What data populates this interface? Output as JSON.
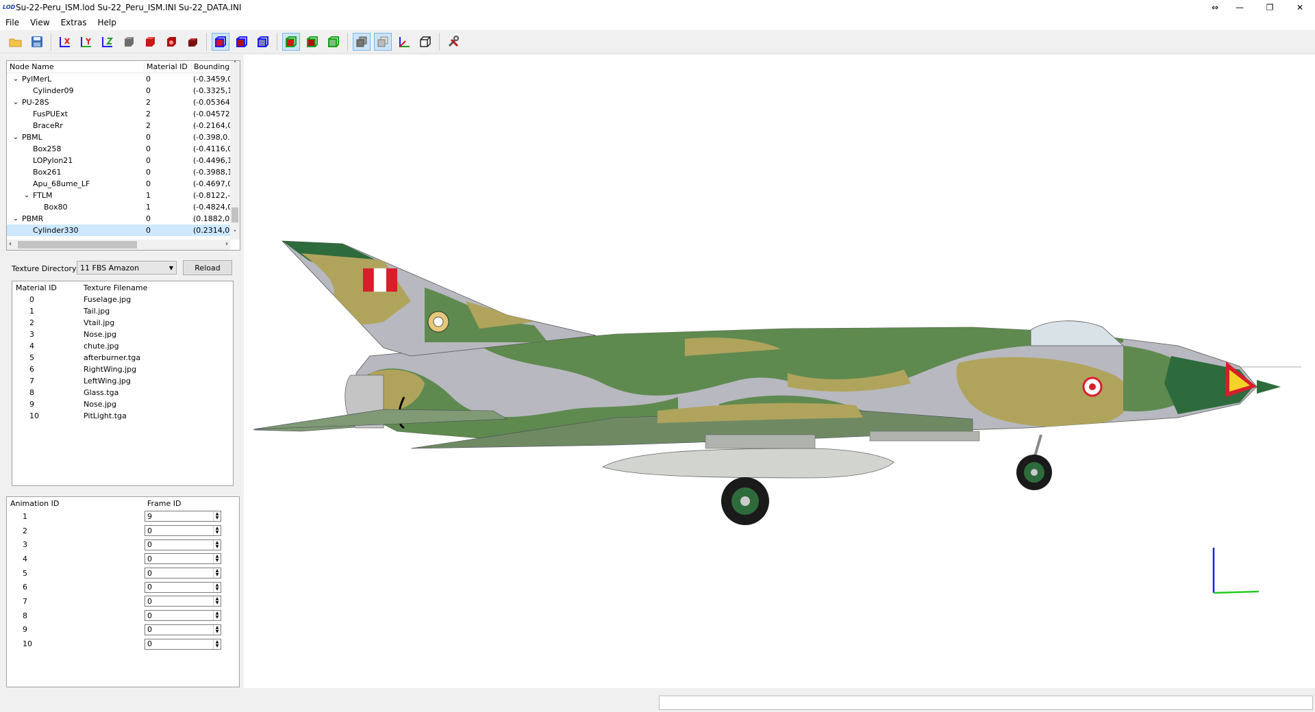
{
  "window": {
    "title": "Su-22-Peru_ISM.lod  Su-22_Peru_ISM.INI  Su-22_DATA.INI",
    "app_icon": "LOD",
    "controls": [
      "resize-icon",
      "minimize-icon",
      "restore-icon",
      "close-icon"
    ]
  },
  "menu": {
    "items": [
      "File",
      "View",
      "Extras",
      "Help"
    ]
  },
  "toolbar": {
    "icons": [
      "open-folder-icon",
      "save-icon",
      "rotate-x-icon",
      "rotate-y-icon",
      "rotate-z-icon",
      "shade-gray-icon",
      "shade-red-icon",
      "shade-red-sphere-icon",
      "shade-red-box-icon",
      "cube-blue-icon",
      "cube-blue-solid-icon",
      "cube-blue-outline-icon",
      "cube-green-icon",
      "cube-green-solid-icon",
      "cube-green-outline-icon",
      "layers-icon",
      "layers-alt-icon",
      "axes-icon",
      "box-outline-icon",
      "tools-icon"
    ]
  },
  "node_tree": {
    "headers": [
      "Node Name",
      "Material ID",
      "Bounding"
    ],
    "rows": [
      {
        "indent": 1,
        "expander": "v",
        "name": "PylMerL",
        "material": "0",
        "bounding": "(-0.3459,0"
      },
      {
        "indent": 2,
        "expander": "",
        "name": "Cylinder09",
        "material": "0",
        "bounding": "(-0.3325,1"
      },
      {
        "indent": 1,
        "expander": "v",
        "name": "PU-28S",
        "material": "2",
        "bounding": "(-0.05364,"
      },
      {
        "indent": 2,
        "expander": "",
        "name": "FusPUExt",
        "material": "2",
        "bounding": "(-0.04572,"
      },
      {
        "indent": 2,
        "expander": "",
        "name": "BraceRr",
        "material": "2",
        "bounding": "(-0.2164,0"
      },
      {
        "indent": 1,
        "expander": "v",
        "name": "PBML",
        "material": "0",
        "bounding": "(-0.398,0."
      },
      {
        "indent": 2,
        "expander": "",
        "name": "Box258",
        "material": "0",
        "bounding": "(-0.4116,0"
      },
      {
        "indent": 2,
        "expander": "",
        "name": "LOPylon21",
        "material": "0",
        "bounding": "(-0.4496,1"
      },
      {
        "indent": 2,
        "expander": "",
        "name": "Box261",
        "material": "0",
        "bounding": "(-0.3988,1"
      },
      {
        "indent": 2,
        "expander": "",
        "name": "Apu_68ume_LF",
        "material": "0",
        "bounding": "(-0.4697,0"
      },
      {
        "indent": 2,
        "expander": "v",
        "name": "FTLM",
        "material": "1",
        "bounding": "(-0.8122,-"
      },
      {
        "indent": 3,
        "expander": "",
        "name": "Box80",
        "material": "1",
        "bounding": "(-0.4824,0"
      },
      {
        "indent": 1,
        "expander": "v",
        "name": "PBMR",
        "material": "0",
        "bounding": "(0.1882,0."
      },
      {
        "indent": 2,
        "expander": "",
        "name": "Cylinder330",
        "material": "0",
        "bounding": "(0.2314,0."
      }
    ]
  },
  "texture": {
    "dir_label": "Texture Directory:",
    "dir_value": "11 FBS Amazon",
    "reload_label": "Reload",
    "headers": [
      "Material ID",
      "Texture Filename"
    ],
    "rows": [
      {
        "id": "0",
        "file": "Fuselage.jpg"
      },
      {
        "id": "1",
        "file": "Tail.jpg"
      },
      {
        "id": "2",
        "file": "Vtail.jpg"
      },
      {
        "id": "3",
        "file": "Nose.jpg"
      },
      {
        "id": "4",
        "file": "chute.jpg"
      },
      {
        "id": "5",
        "file": "afterburner.tga"
      },
      {
        "id": "6",
        "file": "RightWing.jpg"
      },
      {
        "id": "7",
        "file": "LeftWing.jpg"
      },
      {
        "id": "8",
        "file": "Glass.tga"
      },
      {
        "id": "9",
        "file": "Nose.jpg"
      },
      {
        "id": "10",
        "file": "PitLight.tga"
      }
    ]
  },
  "animation": {
    "headers": [
      "Animation ID",
      "Frame ID"
    ],
    "rows": [
      {
        "id": "1",
        "frame": "9"
      },
      {
        "id": "2",
        "frame": "0"
      },
      {
        "id": "3",
        "frame": "0"
      },
      {
        "id": "4",
        "frame": "0"
      },
      {
        "id": "5",
        "frame": "0"
      },
      {
        "id": "6",
        "frame": "0"
      },
      {
        "id": "7",
        "frame": "0"
      },
      {
        "id": "8",
        "frame": "0"
      },
      {
        "id": "9",
        "frame": "0"
      },
      {
        "id": "10",
        "frame": "0"
      }
    ]
  },
  "viewport": {
    "model": "aircraft-3d-model",
    "axes": "axis-gizmo"
  },
  "colors": {
    "selection": "#cde8ff",
    "camo_green": "#5f8a4f",
    "camo_tan": "#b0a45d",
    "camo_gray": "#b8b8c0",
    "dark_green": "#2e6b3c",
    "flag_red": "#d81e2a",
    "axis_blue": "#1a1aff",
    "axis_green": "#22cc22"
  }
}
